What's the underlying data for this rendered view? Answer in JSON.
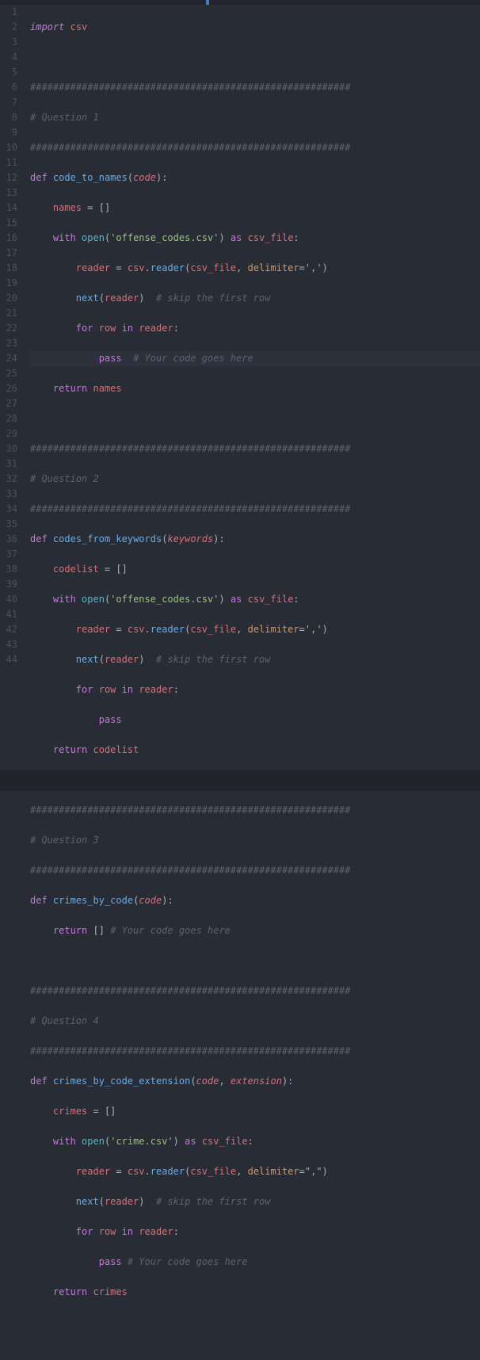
{
  "gutter": {
    "max": 44
  },
  "tokens": {
    "import": "import",
    "def": "def",
    "return": "return",
    "with": "with",
    "as": "as",
    "for": "for",
    "in": "in",
    "pass": "pass",
    "open": "open",
    "next": "next"
  },
  "idents": {
    "csv": "csv",
    "code_to_names": "code_to_names",
    "codes_from_keywords": "codes_from_keywords",
    "crimes_by_code": "crimes_by_code",
    "crimes_by_code_extension": "crimes_by_code_extension",
    "code": "code",
    "keywords": "keywords",
    "extension": "extension",
    "names": "names",
    "codelist": "codelist",
    "crimes": "crimes",
    "csv_file": "csv_file",
    "reader": "reader",
    "row": "row",
    "delimiter": "delimiter"
  },
  "strings": {
    "offense": "'offense_codes.csv'",
    "crime": "'crime.csv'",
    "comma_sq": "','",
    "comma_dq": "\",\""
  },
  "comments": {
    "hashes": "########################################################",
    "q1": "# Question 1",
    "q2": "# Question 2",
    "q3": "# Question 3",
    "q4": "# Question 4",
    "skip": "# skip the first row",
    "todo": "# Your code goes here"
  },
  "punc": {
    "lp": "(",
    "rp": ")",
    "colon": ":",
    "eq": " = ",
    "brackets": "[]",
    "comma_sp": ", ",
    "dot": "."
  }
}
